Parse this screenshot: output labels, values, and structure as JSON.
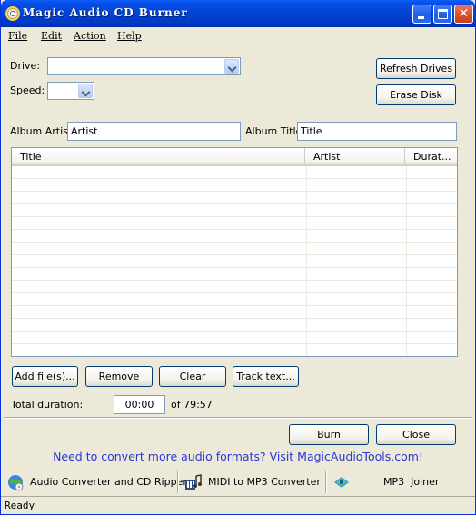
{
  "window": {
    "title": "Magic Audio CD Burner"
  },
  "menu": [
    "File",
    "Edit",
    "Action",
    "Help"
  ],
  "drive": {
    "label": "Drive:",
    "value": ""
  },
  "speed": {
    "label": "Speed:",
    "value": ""
  },
  "buttons": {
    "refresh": "Refresh Drives",
    "erase": "Erase Disk",
    "add_files": "Add file(s)...",
    "remove": "Remove",
    "clear": "Clear",
    "track_text": "Track text...",
    "burn": "Burn",
    "close": "Close"
  },
  "album_artist": {
    "label": "Album Artist:",
    "value": "Artist"
  },
  "album_title": {
    "label": "Album Title:",
    "value": "Title"
  },
  "tracks": {
    "columns": [
      "Title",
      "Artist",
      "Durat..."
    ],
    "rows": []
  },
  "duration": {
    "label": "Total duration:",
    "value": "00:00",
    "total": "of 79:57"
  },
  "promo_link": "Need to convert more audio formats? Visit MagicAudioTools.com!",
  "footer": {
    "converter": "Audio Converter and CD Ripper",
    "midi": "MIDI to MP3 Converter",
    "joiner": "MP3  Joiner"
  },
  "status": "Ready",
  "icons": {
    "app": "cd-icon",
    "converter": "globe-converter-icon",
    "midi": "midi-icon",
    "joiner": "joiner-icon"
  },
  "colors": {
    "titlebar": "#0243d3",
    "window_bg": "#ece9d8",
    "link": "#2a36d6",
    "close_button": "#d8512c"
  }
}
